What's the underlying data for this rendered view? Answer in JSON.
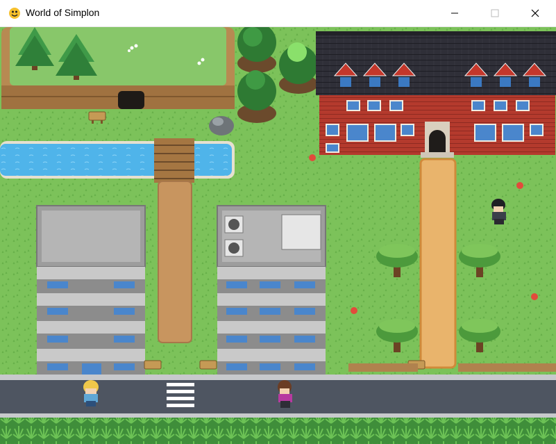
{
  "window": {
    "title": "World of Simplon",
    "controls": {
      "minimize_icon": "minimize-icon",
      "maximize_icon": "maximize-icon",
      "close_icon": "close-icon"
    }
  },
  "scene": {
    "palette": {
      "grass": "#7cc25a",
      "grass_dark": "#5aa544",
      "water": "#4fb4ea",
      "road": "#4e5561",
      "path": "#e9b46c",
      "brick": "#b43a2d",
      "roof": "#2a2a33"
    },
    "buildings": [
      "school-building",
      "apartment-left",
      "apartment-right"
    ],
    "characters": [
      "player-blonde",
      "npc-brown-hair",
      "npc-dark-hair"
    ]
  }
}
